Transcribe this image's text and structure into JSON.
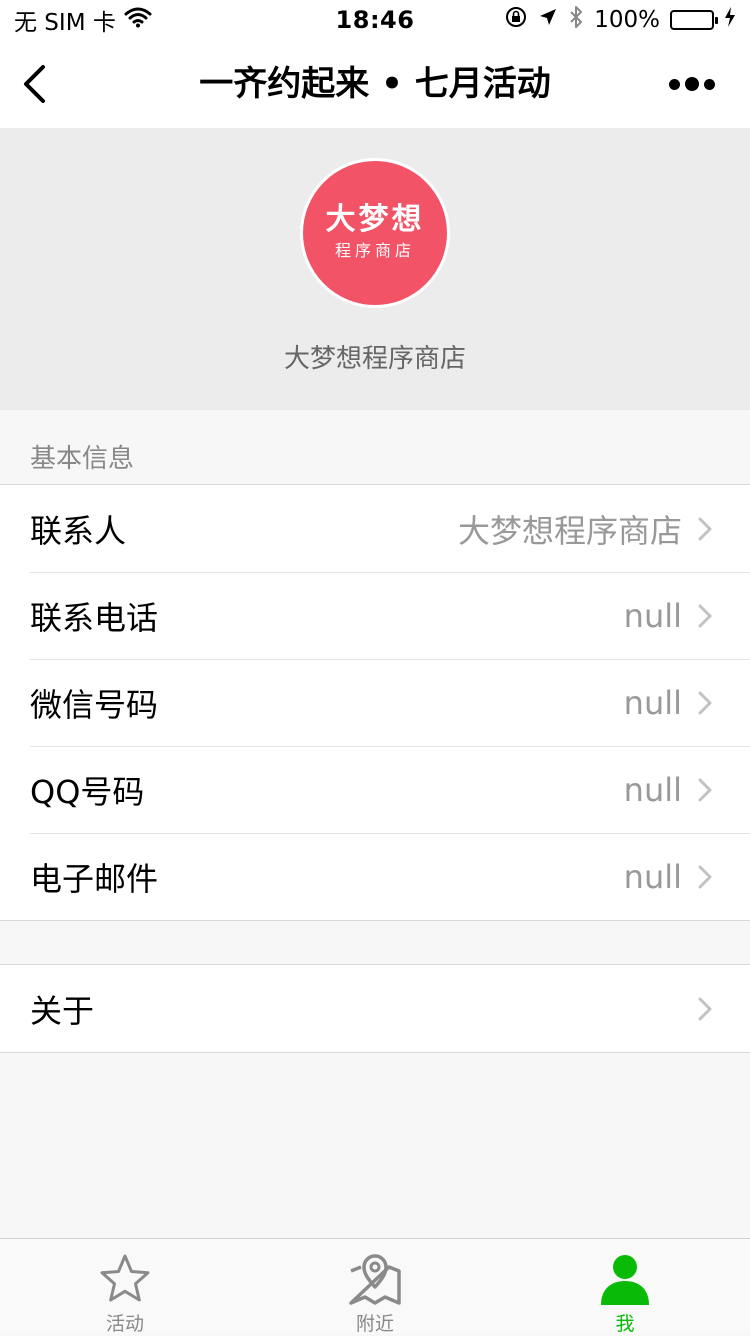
{
  "status_bar": {
    "carrier": "无 SIM 卡",
    "time": "18:46",
    "battery": "100%"
  },
  "nav": {
    "title": "一齐约起来 • 七月活动"
  },
  "profile": {
    "logo_main": "大梦想",
    "logo_sub": "程序商店",
    "store_name": "大梦想程序商店",
    "logo_color": "#f25366"
  },
  "section": {
    "basic_info": "基本信息"
  },
  "info_items": [
    {
      "label": "联系人",
      "value": "大梦想程序商店"
    },
    {
      "label": "联系电话",
      "value": "null"
    },
    {
      "label": "微信号码",
      "value": "null"
    },
    {
      "label": "QQ号码",
      "value": "null"
    },
    {
      "label": "电子邮件",
      "value": "null"
    }
  ],
  "about": {
    "label": "关于"
  },
  "tabs": [
    {
      "label": "活动",
      "icon": "star-icon",
      "active": false
    },
    {
      "label": "附近",
      "icon": "map-pin-icon",
      "active": false
    },
    {
      "label": "我",
      "icon": "user-icon",
      "active": true
    }
  ],
  "colors": {
    "accent_green": "#09bb07",
    "battery_green": "#4cd964"
  }
}
